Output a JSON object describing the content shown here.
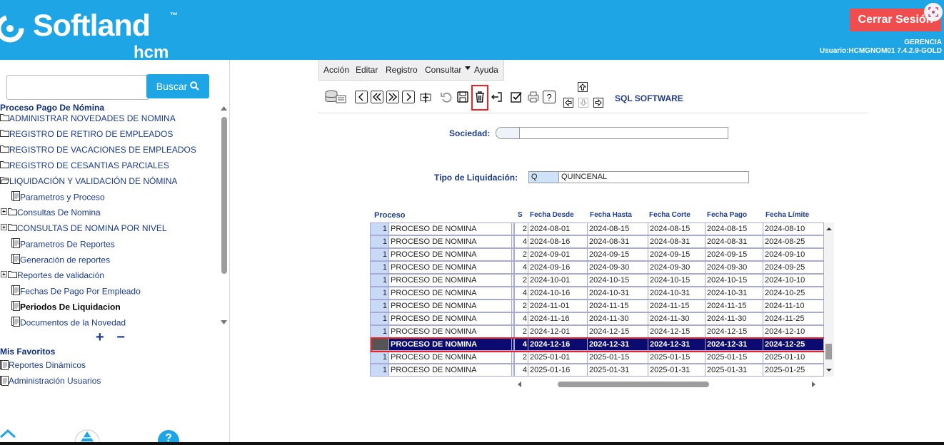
{
  "header": {
    "brand": "Softland",
    "tm": "™",
    "sub": "hcm",
    "logout_label": "Cerrar Sesión",
    "company": "GERENCIA",
    "user_line": "Usuario:HCMGNOM01 7.4.2.9-GOLD",
    "colors": {
      "bar": "#1ea5e6",
      "logout": "#f04e4e"
    }
  },
  "sidebar": {
    "search_placeholder": "",
    "search_button": "Buscar",
    "tree_title": "Proceso Pago De Nómina",
    "items": [
      {
        "label": "ADMINISTRAR NOVEDADES DE NOMINA",
        "icon": "folder-icon"
      },
      {
        "label": "REGISTRO DE RETIRO DE EMPLEADOS",
        "icon": "folder-icon"
      },
      {
        "label": "REGISTRO DE VACACIONES DE EMPLEADOS",
        "icon": "folder-icon"
      },
      {
        "label": "REGISTRO DE CESANTIAS PARCIALES",
        "icon": "folder-icon"
      },
      {
        "label": "LIQUIDACIÓN Y VALIDACIÓN DE NÓMINA",
        "icon": "folder-open-icon"
      },
      {
        "label": "Parametros y Proceso",
        "icon": "document-icon"
      },
      {
        "label": "Consultas De Nomina",
        "icon": "folder-icon"
      },
      {
        "label": "CONSULTAS DE NOMINA POR NIVEL",
        "icon": "folder-icon"
      },
      {
        "label": "Parametros De Reportes",
        "icon": "document-icon"
      },
      {
        "label": "Generación de reportes",
        "icon": "document-icon"
      },
      {
        "label": "Reportes de validación",
        "icon": "folder-icon"
      },
      {
        "label": "Fechas De Pago Por Empleado",
        "icon": "document-icon"
      },
      {
        "label": "Periodos De Liquidacion",
        "icon": "document-icon",
        "selected": true
      },
      {
        "label": "Documentos de la Novedad",
        "icon": "document-icon"
      }
    ],
    "expand_controls": "+ −",
    "favorites_title": "Mis Favoritos",
    "favorites": [
      "Reportes Dinámicos",
      "Administración Usuarios"
    ]
  },
  "menu": [
    "Acción",
    "Editar",
    "Registro",
    "Consultar",
    "Ayuda"
  ],
  "toolbar": {
    "buttons": [
      "database-icon",
      "prev-icon",
      "first-icon",
      "last-icon",
      "next-icon",
      "insert-icon",
      "undo-icon",
      "save-icon",
      "trash-icon",
      "exit-icon",
      "check-icon",
      "print-icon",
      "help-icon",
      "arrow-up-icon",
      "arrow-left-icon",
      "arrow-down-icon",
      "arrow-right-icon"
    ],
    "vendor": "SQL SOFTWARE"
  },
  "form": {
    "sociedad_label": "Sociedad:",
    "sociedad_value": "",
    "tipo_label": "Tipo de Liquidación:",
    "tipo_code": "Q",
    "tipo_name": "QUINCENAL"
  },
  "grid": {
    "headers": [
      "Proceso",
      "S",
      "Fecha Desde",
      "Fecha Hasta",
      "Fecha Corte",
      "Fecha Pago",
      "Fecha Límite"
    ],
    "rows": [
      {
        "n": "1",
        "proceso": "PROCESO DE NOMINA",
        "s": "2",
        "desde": "2024-08-01",
        "hasta": "2024-08-15",
        "corte": "2024-08-15",
        "pago": "2024-08-15",
        "limite": "2024-08-10"
      },
      {
        "n": "1",
        "proceso": "PROCESO DE NOMINA",
        "s": "4",
        "desde": "2024-08-16",
        "hasta": "2024-08-31",
        "corte": "2024-08-31",
        "pago": "2024-08-31",
        "limite": "2024-08-25"
      },
      {
        "n": "1",
        "proceso": "PROCESO DE NOMINA",
        "s": "2",
        "desde": "2024-09-01",
        "hasta": "2024-09-15",
        "corte": "2024-09-15",
        "pago": "2024-09-15",
        "limite": "2024-09-10"
      },
      {
        "n": "1",
        "proceso": "PROCESO DE NOMINA",
        "s": "4",
        "desde": "2024-09-16",
        "hasta": "2024-09-30",
        "corte": "2024-09-30",
        "pago": "2024-09-30",
        "limite": "2024-09-25"
      },
      {
        "n": "1",
        "proceso": "PROCESO DE NOMINA",
        "s": "2",
        "desde": "2024-10-01",
        "hasta": "2024-10-15",
        "corte": "2024-10-15",
        "pago": "2024-10-15",
        "limite": "2024-10-10"
      },
      {
        "n": "1",
        "proceso": "PROCESO DE NOMINA",
        "s": "4",
        "desde": "2024-10-16",
        "hasta": "2024-10-31",
        "corte": "2024-10-31",
        "pago": "2024-10-31",
        "limite": "2024-10-25"
      },
      {
        "n": "1",
        "proceso": "PROCESO DE NOMINA",
        "s": "2",
        "desde": "2024-11-01",
        "hasta": "2024-11-15",
        "corte": "2024-11-15",
        "pago": "2024-11-15",
        "limite": "2024-11-10"
      },
      {
        "n": "1",
        "proceso": "PROCESO DE NOMINA",
        "s": "4",
        "desde": "2024-11-16",
        "hasta": "2024-11-30",
        "corte": "2024-11-30",
        "pago": "2024-11-30",
        "limite": "2024-11-25"
      },
      {
        "n": "1",
        "proceso": "PROCESO DE NOMINA",
        "s": "2",
        "desde": "2024-12-01",
        "hasta": "2024-12-15",
        "corte": "2024-12-15",
        "pago": "2024-12-15",
        "limite": "2024-12-10"
      },
      {
        "n": "",
        "proceso": "PROCESO DE NOMINA",
        "s": "4",
        "desde": "2024-12-16",
        "hasta": "2024-12-31",
        "corte": "2024-12-31",
        "pago": "2024-12-31",
        "limite": "2024-12-25",
        "selected": true
      },
      {
        "n": "1",
        "proceso": "PROCESO DE NOMINA",
        "s": "2",
        "desde": "2025-01-01",
        "hasta": "2025-01-15",
        "corte": "2025-01-15",
        "pago": "2025-01-15",
        "limite": "2025-01-10"
      },
      {
        "n": "1",
        "proceso": "PROCESO DE NOMINA",
        "s": "4",
        "desde": "2025-01-16",
        "hasta": "2025-01-31",
        "corte": "2025-01-31",
        "pago": "2025-01-31",
        "limite": "2025-01-25"
      }
    ]
  }
}
